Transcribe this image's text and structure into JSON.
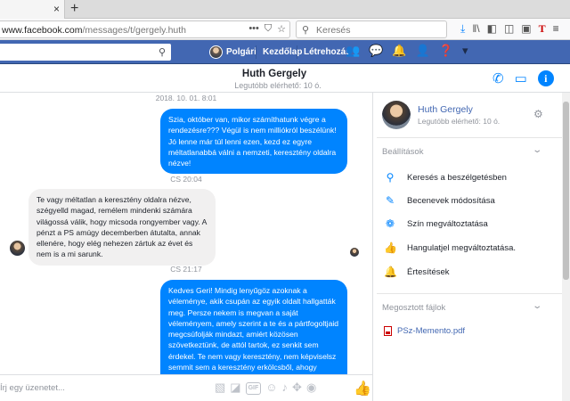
{
  "browser": {
    "tab_close": "×",
    "new_tab": "+",
    "url_host": "www.facebook.com",
    "url_path": "/messages/t/gergely.huth",
    "url_prefix": "",
    "search_placeholder": "Keresés"
  },
  "fb_nav": {
    "user": "Polgári",
    "home": "Kezdőlap",
    "create": "Létrehozás"
  },
  "conversation": {
    "name": "Huth Gergely",
    "status": "Legutóbb elérhető: 10 ó."
  },
  "messages": [
    {
      "timestamp": "2018. 10. 01. 8:01"
    },
    {
      "text": "Szia, október van, mikor számíthatunk végre a rendezésre??? Végül is nem milliókról beszélünk! Jó lenne már túl lenni ezen, kezd ez egyre méltatlanabbá válni a nemzeti, keresztény oldalra nézve!"
    },
    {
      "timestamp": "CS 20:04"
    },
    {
      "text": "Te vagy méltatlan a keresztény oldalra nézve, szégyelld magad, remélem mindenki számára világossá válik, hogy micsoda rongyember vagy. A pénzt a PS amúgy decemberben átutalta, annak ellenére, hogy elég nehezen zártuk az évet és nem is a mi sarunk."
    },
    {
      "timestamp": "CS 21:17"
    },
    {
      "text": "Kedves Geri! Mindig lenyűgöz azoknak a véleménye, akik csupán az egyik oldalt hallgatták meg. Persze nekem is megvan a saját véleményem, amely szerint a te és a pártfogoltjaid megcsúfolják mindazt, amiért közösen szövetkeztünk, de attól tartok, ez senkit sem érdekel. Te nem vagy keresztény, nem képviselsz semmit sem a keresztény erkölcsből, ahogy hazug kebelbarátod, Ervin sem. Hogy te eljuttattad hozzá a szerkesztők"
    }
  ],
  "composer": {
    "placeholder": "Írj egy üzenetet...",
    "gif_label": "GIF"
  },
  "sidebar": {
    "name": "Huth Gergely",
    "status": "Legutóbb elérhető: 10 ó.",
    "settings_title": "Beállítások",
    "options": [
      {
        "label": "Keresés a beszélgetésben",
        "icon": "search-icon"
      },
      {
        "label": "Becenevek módosítása",
        "icon": "pencil-icon"
      },
      {
        "label": "Szín megváltoztatása",
        "icon": "palette-icon"
      },
      {
        "label": "Hangulatjel megváltoztatása.",
        "icon": "thumbs-up-icon"
      },
      {
        "label": "Értesítések",
        "icon": "bell-icon"
      }
    ],
    "files_title": "Megosztott fájlok",
    "files": [
      {
        "name": "PSz-Memento.pdf",
        "icon": "pdf-icon"
      }
    ]
  },
  "colors": {
    "facebook_blue": "#4267b2",
    "messenger_blue": "#0084ff",
    "incoming_bubble": "#f1f0f0"
  }
}
